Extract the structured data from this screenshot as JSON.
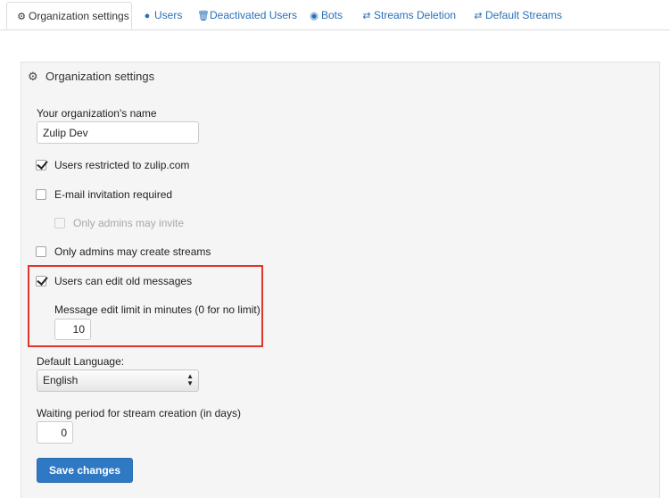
{
  "tabs": [
    {
      "label": "Organization settings",
      "icon": "gear-icon",
      "glyph": "⚙",
      "active": true
    },
    {
      "label": "Users",
      "icon": "user-icon",
      "glyph": "👤",
      "active": false
    },
    {
      "label": "Deactivated Users",
      "icon": "trash-icon",
      "glyph": "🗑",
      "active": false
    },
    {
      "label": "Bots",
      "icon": "github-icon",
      "glyph": "◉",
      "active": false
    },
    {
      "label": "Streams Deletion",
      "icon": "exchange-icon",
      "glyph": "⇄",
      "active": false
    },
    {
      "label": "Default Streams",
      "icon": "exchange-icon",
      "glyph": "⇄",
      "active": false
    }
  ],
  "panel": {
    "title": "Organization settings",
    "title_icon": "gear-icon",
    "title_glyph": "⚙"
  },
  "org_name": {
    "label": "Your organization's name",
    "value": "Zulip Dev"
  },
  "options": {
    "restricted_to_domain": {
      "label": "Users restricted to zulip.com",
      "checked": true
    },
    "invite_required": {
      "label": "E-mail invitation required",
      "checked": false
    },
    "invite_by_admins_only": {
      "label": "Only admins may invite",
      "checked": false,
      "disabled": true
    },
    "create_stream_by_admins_only": {
      "label": "Only admins may create streams",
      "checked": false
    },
    "allow_message_editing": {
      "label": "Users can edit old messages",
      "checked": true
    }
  },
  "message_edit_limit": {
    "label": "Message edit limit in minutes (0 for no limit)",
    "value": "10"
  },
  "default_language": {
    "label": "Default Language:",
    "selected": "English"
  },
  "waiting_period": {
    "label": "Waiting period for stream creation (in days)",
    "value": "0"
  },
  "save_button": {
    "label": "Save changes"
  },
  "colors": {
    "accent": "#2f79c4",
    "link": "#2a6fb7",
    "highlight_border": "#e0352b",
    "panel_bg": "#f5f5f5"
  }
}
